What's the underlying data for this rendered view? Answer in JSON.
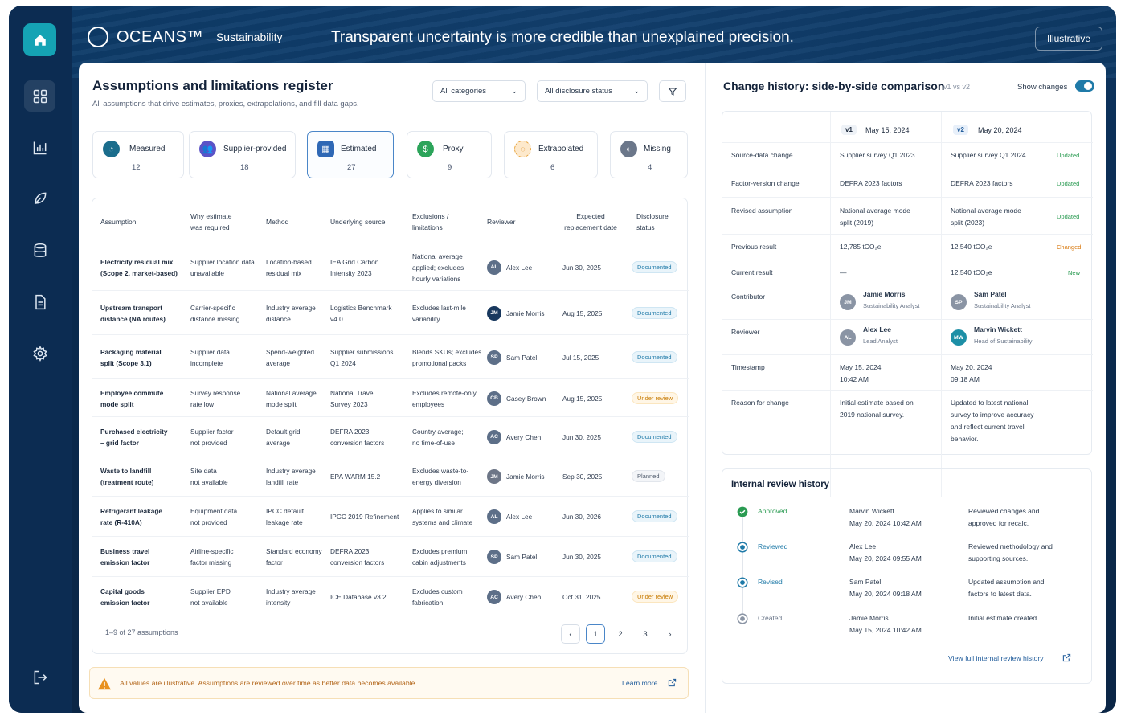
{
  "app": {
    "brand": "OCEANS™",
    "brand_sub": "Sustainability",
    "tagline": "Transparent uncertainty is more credible than unexplained precision.",
    "illustrative": "Illustrative"
  },
  "register": {
    "title": "Assumptions and limitations register",
    "subtitle": "All assumptions that drive estimates, proxies, extrapolations, and fill data gaps.",
    "filter1": "All categories",
    "filter2": "All disclosure status"
  },
  "stats": [
    {
      "label": "Measured",
      "value": "12",
      "color": "#1b6d8c"
    },
    {
      "label": "Supplier-provided",
      "value": "18",
      "color": "#5b53c7"
    },
    {
      "label": "Estimated",
      "value": "27",
      "color": "#2f68b5"
    },
    {
      "label": "Proxy",
      "value": "9",
      "color": "#2ca45a"
    },
    {
      "label": "Extrapolated",
      "value": "6",
      "color": "#e8a33a"
    },
    {
      "label": "Missing",
      "value": "4",
      "color": "#6b778a"
    }
  ],
  "columns": {
    "assumption": "Assumption",
    "why1": "Why estimate",
    "why2": "was required",
    "method": "Method",
    "source": "Underlying source",
    "excl1": "Exclusions /",
    "excl2": "limitations",
    "reviewer": "Reviewer",
    "exp1": "Expected",
    "exp2": "replacement date",
    "disc1": "Disclosure",
    "disc2": "status"
  },
  "rows": [
    {
      "a1": "Electricity residual mix",
      "a2": "(Scope 2, market-based)",
      "w1": "Supplier location data",
      "w2": "unavailable",
      "m1": "Location-based",
      "m2": "residual mix",
      "s1": "IEA Grid Carbon",
      "s2": "Intensity 2023",
      "e1": "National average",
      "e2": "applied; excludes",
      "e3": "hourly variations",
      "ri": "AL",
      "rn": "Alex Lee",
      "rc": "#5d6f88",
      "d": "Jun 30, 2025",
      "st": "Documented",
      "sc": "doc"
    },
    {
      "a1": "Upstream transport",
      "a2": "distance (NA routes)",
      "w1": "Carrier-specific",
      "w2": "distance missing",
      "m1": "Industry average",
      "m2": "distance",
      "s1": "Logistics Benchmark",
      "s2": "v4.0",
      "e1": "Excludes last-mile",
      "e2": "variability",
      "e3": "",
      "ri": "JM",
      "rn": "Jamie Morris",
      "rc": "#18385e",
      "d": "Aug 15, 2025",
      "st": "Documented",
      "sc": "doc"
    },
    {
      "a1": "Packaging material",
      "a2": "split (Scope 3.1)",
      "w1": "Supplier data",
      "w2": "incomplete",
      "m1": "Spend-weighted",
      "m2": "average",
      "s1": "Supplier submissions",
      "s2": "Q1 2024",
      "e1": "Blends SKUs; excludes",
      "e2": "promotional packs",
      "e3": "",
      "ri": "SP",
      "rn": "Sam Patel",
      "rc": "#5d6f88",
      "d": "Jul 15, 2025",
      "st": "Documented",
      "sc": "doc"
    },
    {
      "a1": "Employee commute",
      "a2": "mode split",
      "w1": "Survey response",
      "w2": "rate low",
      "m1": "National average",
      "m2": "mode split",
      "s1": "National Travel",
      "s2": "Survey 2023",
      "e1": "Excludes remote-only",
      "e2": "employees",
      "e3": "",
      "ri": "CB",
      "rn": "Casey Brown",
      "rc": "#5d6f88",
      "d": "Aug 15, 2025",
      "st": "Under review",
      "sc": "rev"
    },
    {
      "a1": "Purchased electricity",
      "a2": "– grid factor",
      "w1": "Supplier factor",
      "w2": "not provided",
      "m1": "Default grid",
      "m2": "average",
      "s1": "DEFRA 2023",
      "s2": "conversion factors",
      "e1": "Country average;",
      "e2": "no time-of-use",
      "e3": "",
      "ri": "AC",
      "rn": "Avery Chen",
      "rc": "#5d6f88",
      "d": "Jun 30, 2025",
      "st": "Documented",
      "sc": "doc"
    },
    {
      "a1": "Waste to landfill",
      "a2": "(treatment route)",
      "w1": "Site data",
      "w2": "not available",
      "m1": "Industry average",
      "m2": "landfill rate",
      "s1": "EPA WARM 15.2",
      "s2": "",
      "e1": "Excludes waste-to-",
      "e2": "energy diversion",
      "e3": "",
      "ri": "JM",
      "rn": "Jamie Morris",
      "rc": "#6d7687",
      "d": "Sep 30, 2025",
      "st": "Planned",
      "sc": "pl"
    },
    {
      "a1": "Refrigerant leakage",
      "a2": "rate (R-410A)",
      "w1": "Equipment data",
      "w2": "not provided",
      "m1": "IPCC default",
      "m2": "leakage rate",
      "s1": "IPCC 2019 Refinement",
      "s2": "",
      "e1": "Applies to similar",
      "e2": "systems and climate",
      "e3": "",
      "ri": "AL",
      "rn": "Alex Lee",
      "rc": "#5d6f88",
      "d": "Jun 30, 2026",
      "st": "Documented",
      "sc": "doc"
    },
    {
      "a1": "Business travel",
      "a2": "emission factor",
      "w1": "Airline-specific",
      "w2": "factor missing",
      "m1": "Standard economy",
      "m2": "factor",
      "s1": "DEFRA 2023",
      "s2": "conversion factors",
      "e1": "Excludes premium",
      "e2": "cabin adjustments",
      "e3": "",
      "ri": "SP",
      "rn": "Sam Patel",
      "rc": "#5d6f88",
      "d": "Jun 30, 2025",
      "st": "Documented",
      "sc": "doc"
    },
    {
      "a1": "Capital goods",
      "a2": "emission factor",
      "w1": "Supplier EPD",
      "w2": "not available",
      "m1": "Industry average",
      "m2": "intensity",
      "s1": "ICE Database v3.2",
      "s2": "",
      "e1": "Excludes custom",
      "e2": "fabrication",
      "e3": "",
      "ri": "AC",
      "rn": "Avery Chen",
      "rc": "#5d6f88",
      "d": "Oct 31, 2025",
      "st": "Under review",
      "sc": "rev"
    }
  ],
  "pagination": {
    "summary": "1–9 of 27 assumptions",
    "pages": [
      "1",
      "2",
      "3"
    ]
  },
  "notice": {
    "text": "All values are illustrative. Assumptions are reviewed over time as better data becomes available.",
    "link": "Learn more"
  },
  "change": {
    "title": "Change history: side-by-side comparison",
    "versions": "v1 vs v2",
    "toggle": "Show changes",
    "v1": {
      "tag": "v1",
      "date": "May 15, 2024"
    },
    "v2": {
      "tag": "v2",
      "date": "May 20, 2024"
    },
    "rows": [
      {
        "label": "Source-data change",
        "v1": "Supplier survey Q1 2023",
        "v2": "Supplier survey Q1 2024",
        "flag": "Updated"
      },
      {
        "label": "Factor-version change",
        "v1": "DEFRA 2023 factors",
        "v2": "DEFRA 2023 factors",
        "flag": "Updated"
      },
      {
        "label": "Revised assumption",
        "v1a": "National average mode",
        "v1b": "split (2019)",
        "v2a": "National average mode",
        "v2b": "split (2023)",
        "flag": "Updated"
      },
      {
        "label": "Previous result",
        "v1": "12,785 tCO₂e",
        "v2": "12,540 tCO₂e",
        "flag": "Changed"
      },
      {
        "label": "Current result",
        "v1": "—",
        "v2": "12,540 tCO₂e",
        "flag": "New"
      }
    ],
    "contributor": {
      "label": "Contributor",
      "v1n": "Jamie Morris",
      "v1r": "Sustainability Analyst",
      "v1i": "JM",
      "v2n": "Sam Patel",
      "v2r": "Sustainability Analyst",
      "v2i": "SP"
    },
    "reviewer": {
      "label": "Reviewer",
      "v1n": "Alex Lee",
      "v1r": "Lead Analyst",
      "v1i": "AL",
      "v2n": "Marvin Wickett",
      "v2r": "Head of Sustainability",
      "v2i": "MW"
    },
    "timestamp": {
      "label": "Timestamp",
      "v1a": "May 15, 2024",
      "v1b": "10:42 AM",
      "v2a": "May 20, 2024",
      "v2b": "09:18 AM"
    },
    "reason": {
      "label": "Reason for change",
      "v1a": "Initial estimate based on",
      "v1b": "2019 national survey.",
      "v2a": "Updated to latest national",
      "v2b": "survey to improve accuracy",
      "v2c": "and reflect current travel",
      "v2d": "behavior."
    }
  },
  "history": {
    "title": "Internal review history",
    "link": "View full internal review history",
    "items": [
      {
        "status": "Approved",
        "who": "Marvin Wickett",
        "when": "May 20, 2024 10:42 AM",
        "n1": "Reviewed changes and",
        "n2": "approved for recalc."
      },
      {
        "status": "Reviewed",
        "who": "Alex Lee",
        "when": "May 20, 2024 09:55 AM",
        "n1": "Reviewed methodology and",
        "n2": "supporting sources."
      },
      {
        "status": "Revised",
        "who": "Sam Patel",
        "when": "May 20, 2024 09:18 AM",
        "n1": "Updated assumption and",
        "n2": "factors to latest data."
      },
      {
        "status": "Created",
        "who": "Jamie Morris",
        "when": "May 15, 2024 10:42 AM",
        "n1": "Initial estimate created.",
        "n2": ""
      }
    ]
  }
}
